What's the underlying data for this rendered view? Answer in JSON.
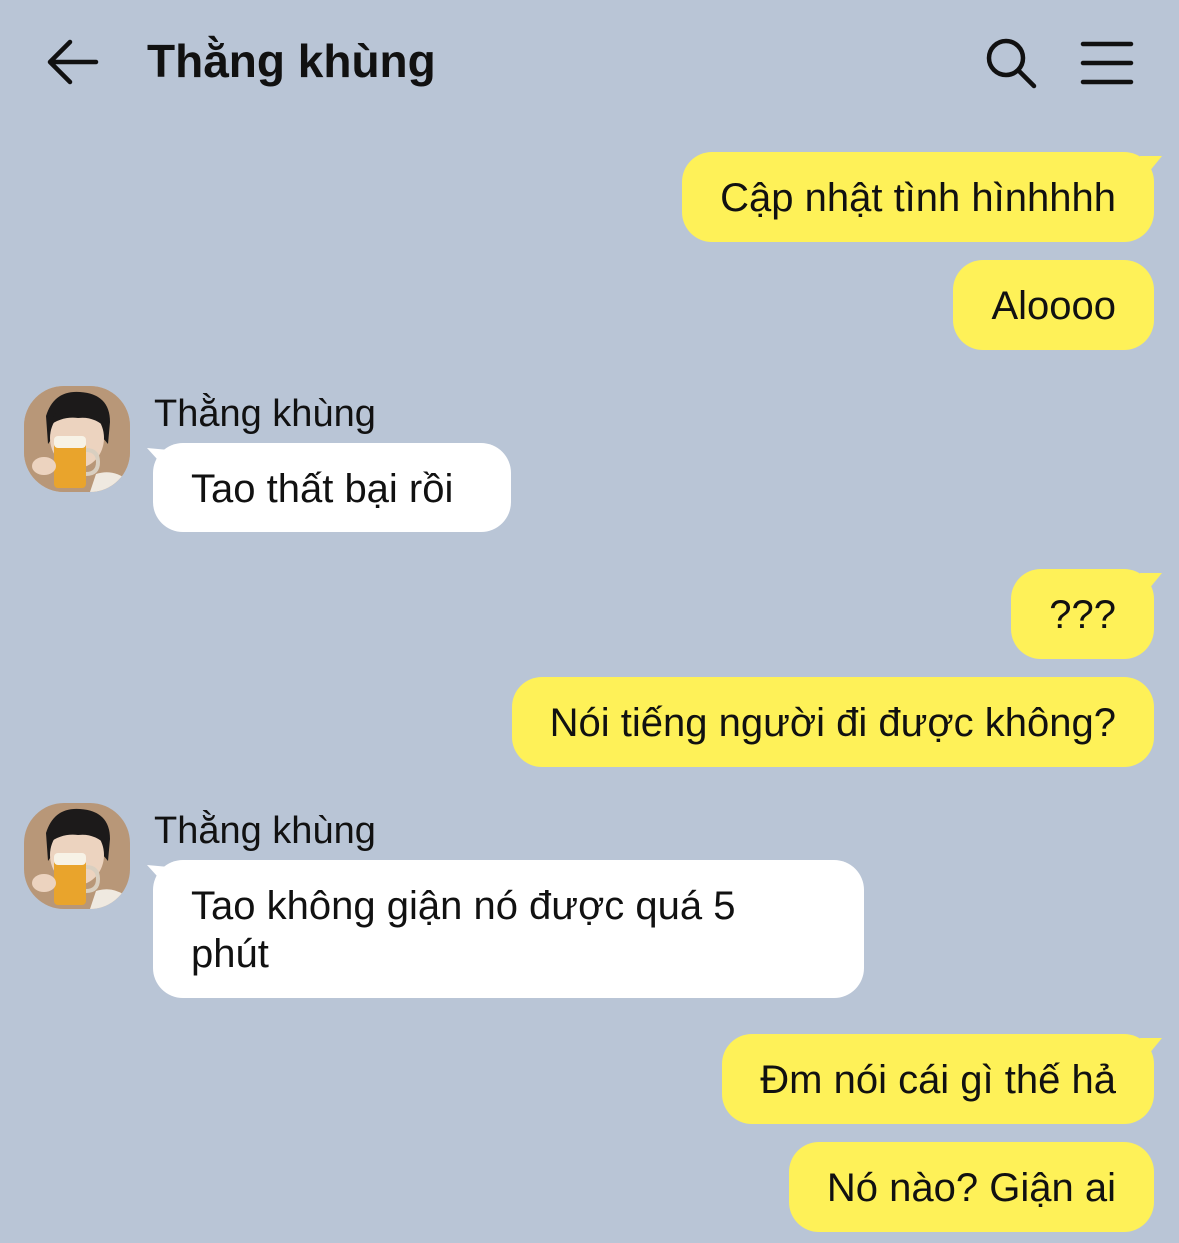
{
  "header": {
    "title": "Thằng khùng"
  },
  "icons": {
    "back": "arrow-left-icon",
    "search": "search-icon",
    "menu": "hamburger-menu-icon"
  },
  "colors": {
    "background": "#b9c5d6",
    "my_bubble": "#fef158",
    "their_bubble": "#ffffff"
  },
  "messages": [
    {
      "from": "me",
      "text": "Cập nhật tình hìnhhhh"
    },
    {
      "from": "me",
      "text": "Aloooo"
    },
    {
      "from": "them",
      "sender": "Thằng khùng",
      "text": "Tao thất bại rồi"
    },
    {
      "from": "me",
      "text": "???"
    },
    {
      "from": "me",
      "text": "Nói tiếng người đi được không?"
    },
    {
      "from": "them",
      "sender": "Thằng khùng",
      "text": "Tao không giận nó được quá 5 phút"
    },
    {
      "from": "me",
      "text": "Đm nói cái gì thế hả"
    },
    {
      "from": "me",
      "text": "Nó nào? Giận ai"
    }
  ]
}
